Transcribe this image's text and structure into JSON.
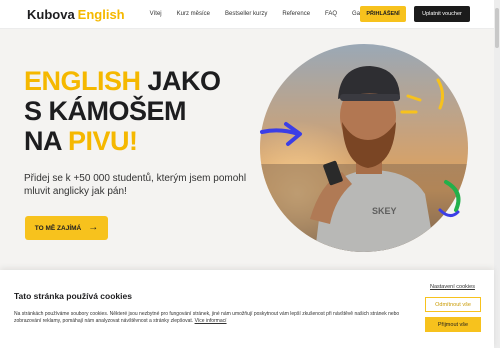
{
  "header": {
    "logo_part1": "Kubova",
    "logo_part2": "English",
    "nav": [
      "Vítej",
      "Kurz měsíce",
      "Bestseller kurzy",
      "Reference",
      "FAQ",
      "Garance"
    ],
    "login_label": "PŘIHLÁŠENÍ",
    "voucher_label": "Uplatnit voucher"
  },
  "hero": {
    "headline_line1_yellow": "ENGLISH",
    "headline_line1_dark": " JAKO",
    "headline_line2": "S KÁMOŠEM",
    "headline_line3_dark": "NA ",
    "headline_line3_yellow": "PIVU!",
    "subtext": "Přidej se k +50 000 studentů, kterým jsem pomohl mluvit anglicky jak pán!",
    "cta_label": "TO MĚ ZAJÍMÁ",
    "cta_arrow": "→"
  },
  "cookie": {
    "title": "Tato stránka používá cookies",
    "text": "Na stránkách používáme soubory cookies. Některé jsou nezbytné pro fungování stránek, jiné nám umožňují poskytnout vám lepší zkušenost při návštěvě našich stránek nebo zobrazování reklamy, pomáhají nám analyzovat návštěvnost a stránky zlepšovat. ",
    "more_link": "Více informací",
    "settings_label": "Nastavení cookies",
    "reject_label": "Odmítnout vše",
    "accept_label": "Přijmout vše"
  },
  "colors": {
    "accent": "#f7c21d",
    "dark": "#1b1b1b",
    "background": "#f4f3f1"
  }
}
